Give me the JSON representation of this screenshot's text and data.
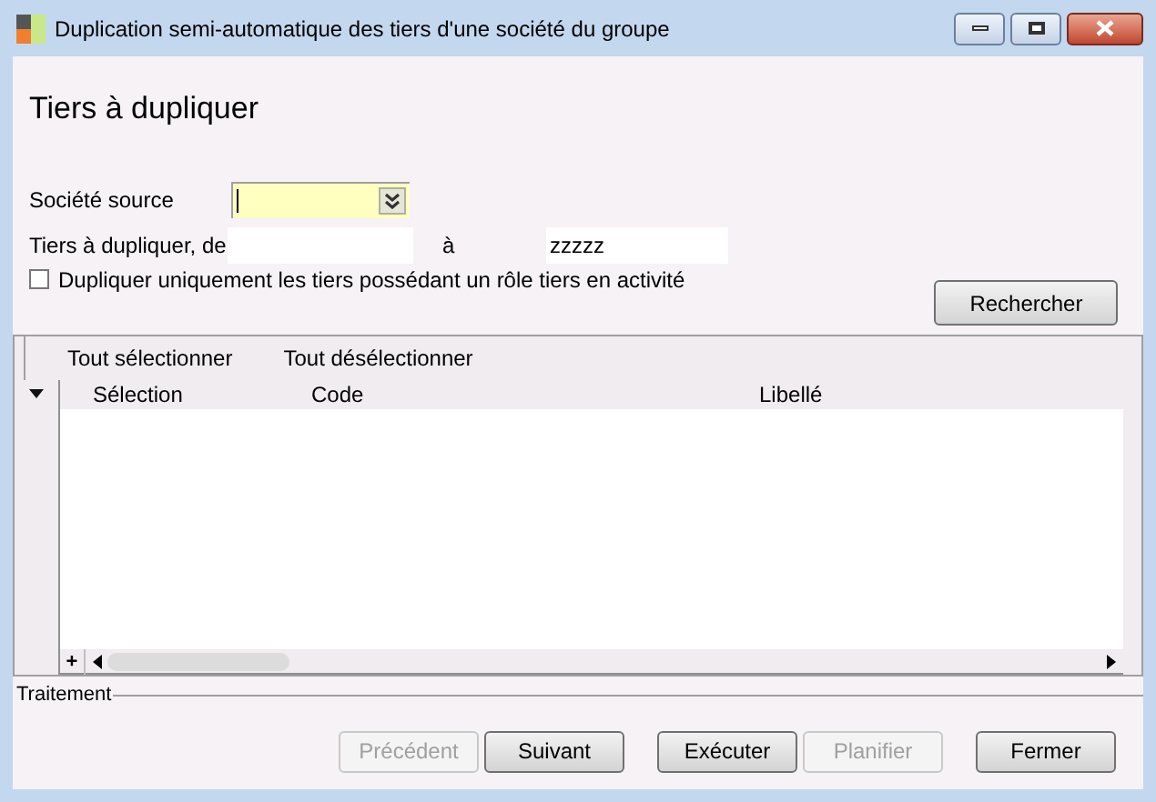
{
  "window": {
    "title": "Duplication semi-automatique des tiers d'une société du groupe"
  },
  "heading": "Tiers à dupliquer",
  "form": {
    "source_label": "Société source",
    "range_label": "Tiers à dupliquer, de",
    "range_to_label": "à",
    "range_to_value": "zzzzz",
    "checkbox": {
      "label": "Dupliquer uniquement les tiers possédant un rôle tiers en activité",
      "checked": false
    },
    "search_button": "Rechercher"
  },
  "grid": {
    "toolbar": [
      "Tout sélectionner",
      "Tout désélectionner"
    ],
    "columns": [
      "Sélection",
      "Code",
      "Libellé"
    ],
    "expand": "+"
  },
  "section": "Traitement",
  "buttons": [
    {
      "label": "Précédent",
      "disabled": true
    },
    {
      "label": "Suivant",
      "disabled": false
    },
    {
      "label": "Exécuter",
      "disabled": false
    },
    {
      "label": "Planifier",
      "disabled": true
    },
    {
      "label": "Fermer",
      "disabled": false
    }
  ]
}
